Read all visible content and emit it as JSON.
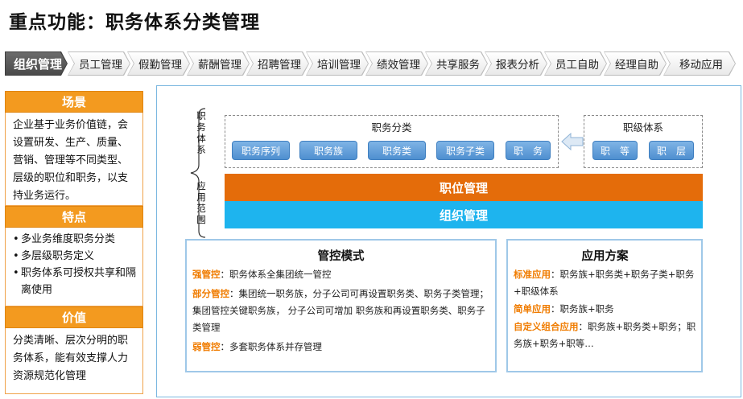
{
  "page": {
    "title": "重点功能：职务体系分类管理"
  },
  "nav": {
    "tabs": [
      "组织管理",
      "员工管理",
      "假勤管理",
      "薪酬管理",
      "招聘管理",
      "培训管理",
      "绩效管理",
      "共享服务",
      "报表分析",
      "员工自助",
      "经理自助",
      "移动应用"
    ],
    "active": "组织管理"
  },
  "left": {
    "scene": {
      "title": "场景",
      "body": "企业基于业务价值链，会设置研发、生产、质量、营销、管理等不同类型、层级的职位和职务，以支持业务运行。"
    },
    "features": {
      "title": "特点",
      "items": [
        "多业务维度职务分类",
        "多层级职务定义",
        "职务体系可授权共享和隔离使用"
      ]
    },
    "value": {
      "title": "价值",
      "body": "分类清晰、层次分明的职务体系，能有效支撑人力资源规范化管理"
    }
  },
  "diagram": {
    "side_top": [
      "职",
      "务",
      "体",
      "系"
    ],
    "side_bottom": [
      "应",
      "用",
      "范",
      "围"
    ],
    "category": {
      "title": "职务分类",
      "items": [
        "职务序列",
        "职务族",
        "职务类",
        "职务子类",
        "职　务"
      ]
    },
    "level": {
      "title": "职级体系",
      "items": [
        "职　等",
        "职　层"
      ]
    },
    "bar_position": "职位管理",
    "bar_org": "组织管理",
    "control": {
      "title": "管控模式",
      "lines": [
        {
          "key": "强管控",
          "text": "：职务体系全集团统一管控"
        },
        {
          "key": "部分管控",
          "text": "：集团统一职务族，分子公司可再设置职务类、职务子类管理；集团管控关键职务族， 分子公司可增加 职务族和再设置职务类、职务子类管理"
        },
        {
          "key": "弱管控",
          "text": "：多套职务体系并存管理"
        }
      ]
    },
    "solution": {
      "title": "应用方案",
      "lines": [
        {
          "key": "标准应用",
          "text": "：职务族+职务类+职务子类+职务+职级体系"
        },
        {
          "key": "简单应用",
          "text": "：职务族+职务"
        },
        {
          "key": "自定义组合应用",
          "text": "：职务族+职务类+职务；职务族+职务+职等…"
        }
      ]
    }
  }
}
